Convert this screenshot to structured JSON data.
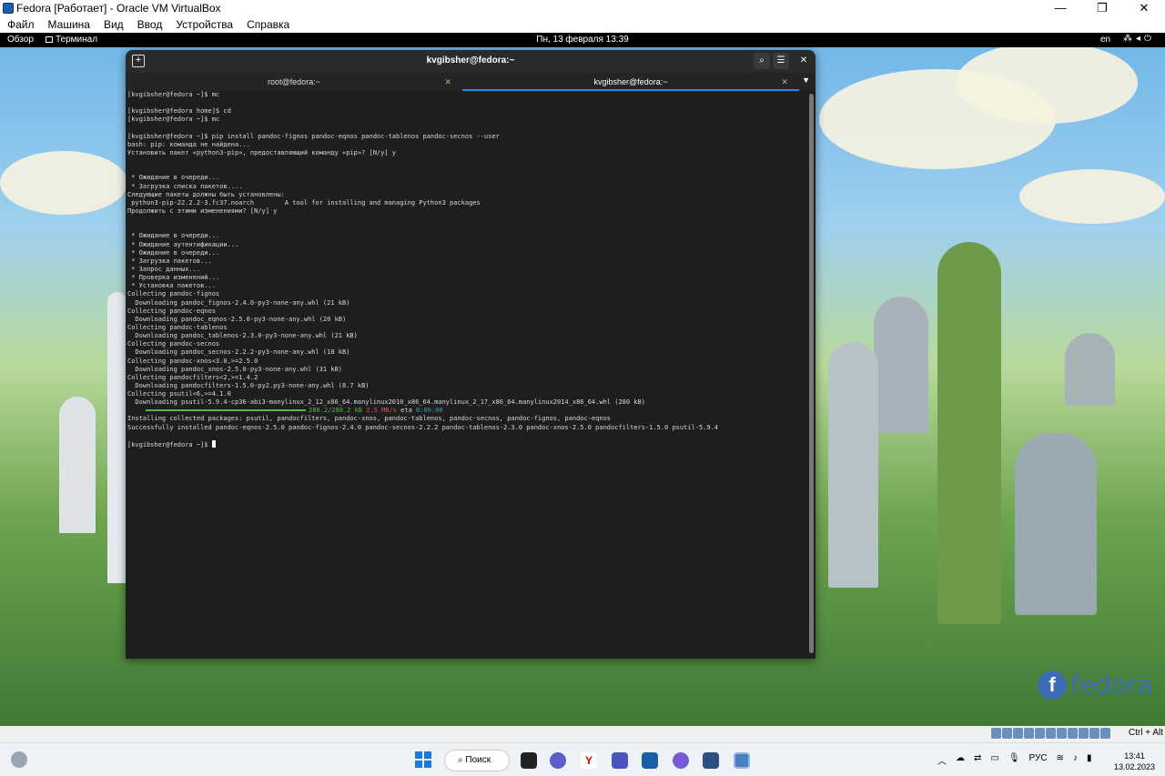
{
  "host_window": {
    "title": "Fedora [Работает] - Oracle VM VirtualBox",
    "minimize": "—",
    "maximize": "❐",
    "close": "✕"
  },
  "host_menu": [
    "Файл",
    "Машина",
    "Вид",
    "Ввод",
    "Устройства",
    "Справка"
  ],
  "gnome_bar": {
    "activities": "Обзор",
    "app": "Терминал",
    "clock": "Пн, 13 февраля 13:39",
    "lang": "en"
  },
  "terminal": {
    "title": "kvgibsher@fedora:~",
    "tabs": [
      {
        "label": "root@fedora:~"
      },
      {
        "label": "kvgibsher@fedora:~"
      }
    ],
    "lines": [
      "[kvgibsher@fedora ~]$ mc",
      "",
      "[kvgibsher@fedora home]$ cd",
      "[kvgibsher@fedora ~]$ mc",
      "",
      "[kvgibsher@fedora ~]$ pip install pandoc-fignos pandoc-eqnos pandoc-tablenos pandoc-secnos --user",
      "bash: pip: команда не найдена...",
      "Установить пакет «python3-pip», предоставляющий команду «pip»? [N/y] y",
      "",
      "",
      " * Ожидание в очереди...",
      " * Загрузка списка пакетов....",
      "Следующие пакеты должны быть установлены:",
      " python3-pip-22.2.2-3.fc37.noarch        A tool for installing and managing Python3 packages",
      "Продолжить с этими изменениями? [N/y] y",
      "",
      "",
      " * Ожидание в очереди...",
      " * Ожидание аутентификации...",
      " * Ожидание в очереди...",
      " * Загрузка пакетов...",
      " * Запрос данных...",
      " * Проверка изменений...",
      " * Установка пакетов...",
      "Collecting pandoc-fignos",
      "  Downloading pandoc_fignos-2.4.0-py3-none-any.whl (21 kB)",
      "Collecting pandoc-eqnos",
      "  Downloading pandoc_eqnos-2.5.0-py3-none-any.whl (20 kB)",
      "Collecting pandoc-tablenos",
      "  Downloading pandoc_tablenos-2.3.0-py3-none-any.whl (21 kB)",
      "Collecting pandoc-secnos",
      "  Downloading pandoc_secnos-2.2.2-py3-none-any.whl (18 kB)",
      "Collecting pandoc-xnos<3.0,>=2.5.0",
      "  Downloading pandoc_xnos-2.5.0-py3-none-any.whl (31 kB)",
      "Collecting pandocfilters<2,>=1.4.2",
      "  Downloading pandocfilters-1.5.0-py2.py3-none-any.whl (8.7 kB)",
      "Collecting psutil<6,>=4.1.0",
      "  Downloading psutil-5.9.4-cp36-abi3-manylinux_2_12_x86_64.manylinux2010_x86_64.manylinux_2_17_x86_64.manylinux2014_x86_64.whl (280 kB)"
    ],
    "progress": {
      "fraction": 1.0,
      "size": "280.2/280.2 kB",
      "speed": "2.5 MB/s",
      "eta_label": "eta",
      "eta": "0:00:00"
    },
    "lines_after": [
      "Installing collected packages: psutil, pandocfilters, pandoc-xnos, pandoc-tablenos, pandoc-secnos, pandoc-fignos, pandoc-eqnos",
      "Successfully installed pandoc-eqnos-2.5.0 pandoc-fignos-2.4.0 pandoc-secnos-2.2.2 pandoc-tablenos-2.3.0 pandoc-xnos-2.5.0 pandocfilters-1.5.0 psutil-5.9.4",
      ""
    ],
    "prompt": "[kvgibsher@fedora ~]$ "
  },
  "wallpaper_logo": "fedora",
  "host_status": {
    "hostkey": "Ctrl + Alt"
  },
  "taskbar": {
    "search": "Поиск",
    "lang": "РУС",
    "time": "13:41",
    "date": "13.02.2023"
  }
}
